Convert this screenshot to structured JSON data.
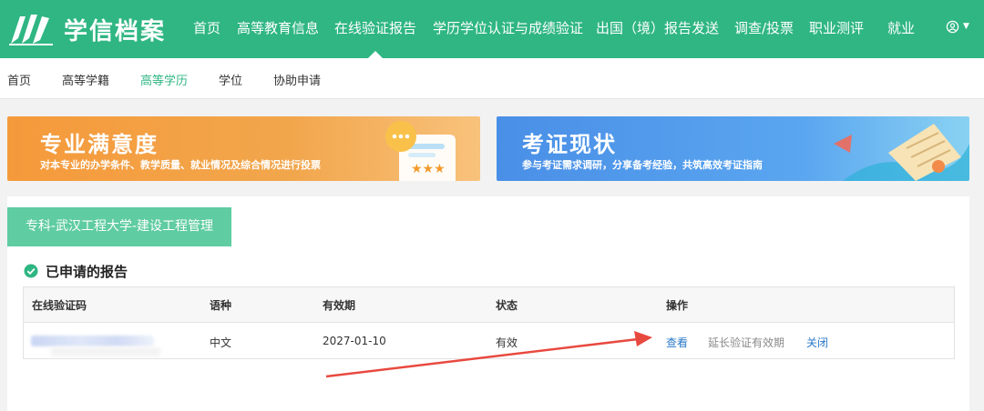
{
  "header": {
    "brand": "学信档案",
    "nav": [
      {
        "label": "首页"
      },
      {
        "label": "高等教育信息"
      },
      {
        "label": "在线验证报告"
      },
      {
        "label": "学历学位认证与成绩验证"
      },
      {
        "label": "出国（境）报告发送"
      },
      {
        "label": "调查/投票"
      },
      {
        "label": "职业测评"
      },
      {
        "label": "就业"
      }
    ],
    "active_nav": "在线验证报告",
    "user_icon": "user-circle-icon"
  },
  "subnav": {
    "items": [
      {
        "label": "首页"
      },
      {
        "label": "高等学籍"
      },
      {
        "label": "高等学历"
      },
      {
        "label": "学位"
      },
      {
        "label": "协助申请"
      }
    ],
    "active": "高等学历"
  },
  "banners": [
    {
      "title": "专业满意度",
      "subtitle": "对本专业的办学条件、教学质量、就业情况及综合情况进行投票"
    },
    {
      "title": "考证现状",
      "subtitle": "参与考证需求调研，分享备考经验，共筑高效考证指南"
    }
  ],
  "major_tab": "专科-武汉工程大学-建设工程管理",
  "section_title": "已申请的报告",
  "table": {
    "headers": [
      "在线验证码",
      "语种",
      "有效期",
      "状态",
      "操作"
    ],
    "rows": [
      {
        "code": "",
        "language": "中文",
        "expiry": "2027-01-10",
        "status": "有效",
        "actions": [
          "查看",
          "延长验证有效期",
          "关闭"
        ]
      }
    ]
  },
  "colors": {
    "primary_green": "#2fb683",
    "tab_green": "#5fcca1",
    "link_blue": "#2b79c8",
    "arrow_red": "#e8493f"
  }
}
